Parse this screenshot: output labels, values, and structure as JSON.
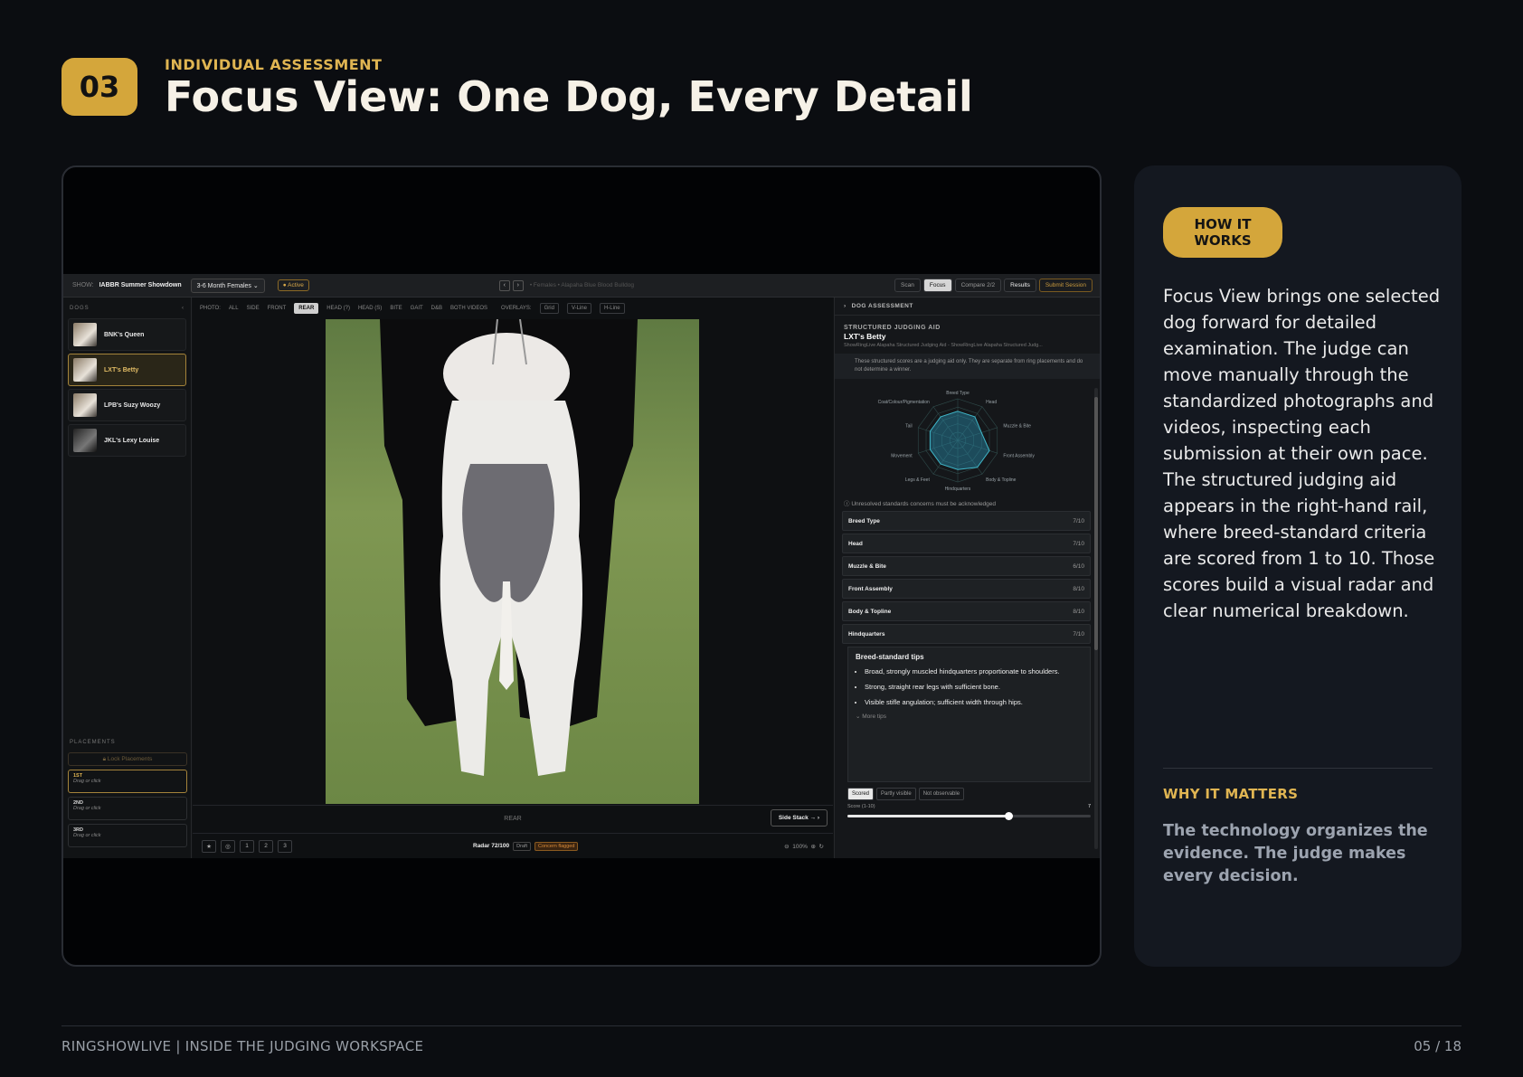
{
  "header": {
    "badge": "03",
    "eyebrow": "INDIVIDUAL ASSESSMENT",
    "title": "Focus View: One Dog, Every Detail"
  },
  "app": {
    "topbar": {
      "show_label": "SHOW:",
      "show_name": "IABBR Summer Showdown",
      "class_select": "3-6 Month Females",
      "status": "● Active",
      "breadcrumb": "• Females • Alapaha Blue Blood Bulldog",
      "modes": [
        "Scan",
        "Focus",
        "Compare 2/2"
      ],
      "results": "Results",
      "submit": "Submit Session"
    },
    "dogs": {
      "heading": "DOGS",
      "items": [
        "BNK's Queen",
        "LXT's Betty",
        "LPB's Suzy Woozy",
        "JKL's Lexy Louise"
      ],
      "selected": "LXT's Betty"
    },
    "placements": {
      "heading": "PLACEMENTS",
      "lock": "Lock Placements",
      "slots": [
        {
          "rank": "1ST",
          "hint": "Drag or click"
        },
        {
          "rank": "2ND",
          "hint": "Drag or click"
        },
        {
          "rank": "3RD",
          "hint": "Drag or click"
        }
      ]
    },
    "photo_tabs": {
      "label": "PHOTO:",
      "tabs": [
        "ALL",
        "SIDE",
        "FRONT",
        "REAR",
        "HEAD (?)",
        "HEAD (S)",
        "BITE",
        "GAIT",
        "D&B",
        "BOTH VIDEOS"
      ],
      "active": "REAR",
      "overlay_label": "OVERLAYS:",
      "overlays": [
        "Grid",
        "V-Line",
        "H-Line"
      ]
    },
    "photo_caption": "REAR",
    "side_stack": "Side Stack →",
    "bottombar": {
      "buttons": [
        "★",
        "◎",
        "1",
        "2",
        "3"
      ],
      "radar": "Radar 72/100",
      "draft": "Draft",
      "concern": "Concern flagged",
      "zoom": "100%"
    },
    "rail": {
      "heading": "DOG ASSESSMENT",
      "section": "STRUCTURED JUDGING AID",
      "dog_name": "LXT's Betty",
      "subtitle": "ShowRingLive Alapaha Structured Judging Aid - ShowRingLive Alapaha Structured Judg...",
      "notice": "These structured scores are a judging aid only. They are separate from ring placements and do not determine a winner.",
      "radar_labels": [
        "Breed Type",
        "Head",
        "Muzzle & Bite",
        "Front Assembly",
        "Body & Topline",
        "Hindquarters",
        "Legs & Feet",
        "Movement",
        "Tail",
        "Coat/Colour/Pigmentation"
      ],
      "radar_values": [
        7,
        7,
        6,
        8,
        8,
        7,
        7,
        7,
        7,
        7
      ],
      "unresolved": "Unresolved standards concerns must be acknowledged",
      "criteria": [
        {
          "name": "Breed Type",
          "score": "7/10"
        },
        {
          "name": "Head",
          "score": "7/10"
        },
        {
          "name": "Muzzle & Bite",
          "score": "6/10"
        },
        {
          "name": "Front Assembly",
          "score": "8/10"
        },
        {
          "name": "Body & Topline",
          "score": "8/10"
        },
        {
          "name": "Hindquarters",
          "score": "7/10"
        }
      ],
      "tips_title": "Breed-standard tips",
      "tips": [
        "Broad, strongly muscled hindquarters proportionate to shoulders.",
        "Strong, straight rear legs with sufficient bone.",
        "Visible stifle angulation; sufficient width through hips."
      ],
      "more_tips": "More tips",
      "observe": [
        "Scored",
        "Partly visible",
        "Not observable"
      ],
      "score_label": "Score (1-10)",
      "score_value": "7",
      "score_fraction": 0.66
    }
  },
  "panel": {
    "how_label": "HOW IT WORKS",
    "how_body": "Focus View brings one selected dog forward for detailed examination. The judge can move manually through the standardized photographs and videos, inspecting each submission at their own pace. The structured judging aid appears in the right-hand rail, where breed-standard criteria are scored from 1 to 10. Those scores build a visual radar and clear numerical breakdown.",
    "why_label": "WHY IT MATTERS",
    "why_body": "The technology organizes the evidence. The judge makes every decision."
  },
  "footer": {
    "left": "RINGSHOWLIVE | INSIDE THE JUDGING WORKSPACE",
    "right": "05 / 18"
  },
  "colors": {
    "accent": "#d4a63b",
    "background": "#0b0d11",
    "panel": "#141820"
  }
}
